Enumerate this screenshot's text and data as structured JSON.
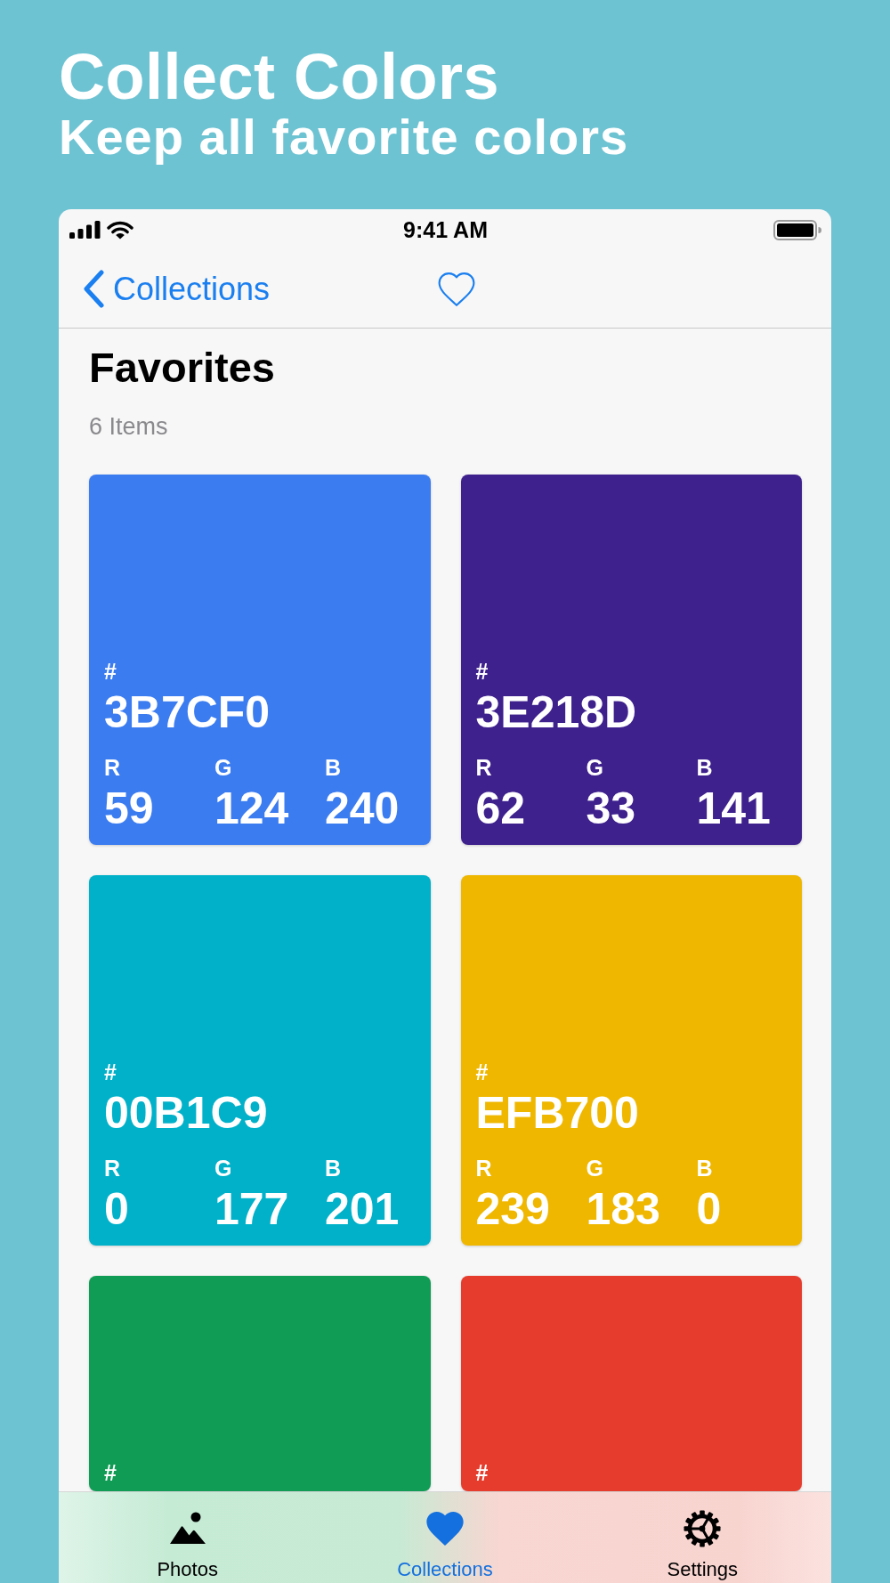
{
  "header": {
    "title": "Collect Colors",
    "subtitle": "Keep all favorite colors"
  },
  "status_bar": {
    "time": "9:41 AM"
  },
  "nav_bar": {
    "back_label": "Collections"
  },
  "page": {
    "title": "Favorites",
    "count": "6 Items"
  },
  "cards": [
    {
      "color": "#3b7cf0",
      "prefix": "#",
      "hex": "3B7CF0",
      "channels": [
        {
          "label": "R",
          "value": "59"
        },
        {
          "label": "G",
          "value": "124"
        },
        {
          "label": "B",
          "value": "240"
        }
      ]
    },
    {
      "color": "#3e218d",
      "prefix": "#",
      "hex": "3E218D",
      "channels": [
        {
          "label": "R",
          "value": "62"
        },
        {
          "label": "G",
          "value": "33"
        },
        {
          "label": "B",
          "value": "141"
        }
      ]
    },
    {
      "color": "#00b1c9",
      "prefix": "#",
      "hex": "00B1C9",
      "channels": [
        {
          "label": "R",
          "value": "0"
        },
        {
          "label": "G",
          "value": "177"
        },
        {
          "label": "B",
          "value": "201"
        }
      ]
    },
    {
      "color": "#efb700",
      "prefix": "#",
      "hex": "EFB700",
      "channels": [
        {
          "label": "R",
          "value": "239"
        },
        {
          "label": "G",
          "value": "183"
        },
        {
          "label": "B",
          "value": "0"
        }
      ]
    },
    {
      "color": "#109c55",
      "prefix": "#"
    },
    {
      "color": "#e63c2d",
      "prefix": "#"
    }
  ],
  "tabs": [
    {
      "label": "Photos",
      "selected": false
    },
    {
      "label": "Collections",
      "selected": true
    },
    {
      "label": "Settings",
      "selected": false
    }
  ]
}
